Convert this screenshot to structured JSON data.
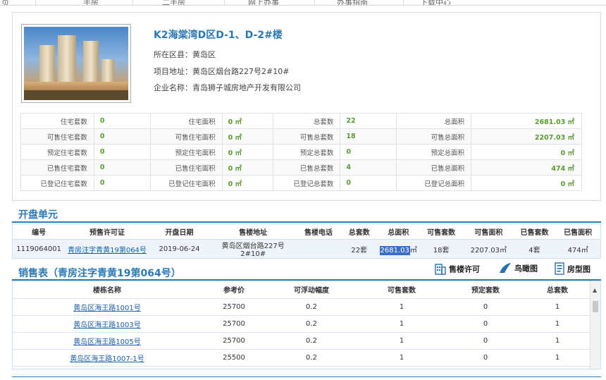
{
  "nav": [
    "页",
    "手房",
    "二手房",
    "网上办事",
    "办事指南",
    "下载中心"
  ],
  "project": {
    "title": "K2海棠湾D区D-1、D-2#楼",
    "district_label": "所在区县：",
    "district": "黄岛区",
    "address_label": "项目地址：",
    "address": "黄岛区烟台路227号2#10#",
    "company_label": "企业名称：",
    "company": "青岛狮子城房地产开发有限公司"
  },
  "stats": [
    [
      "住宅套数",
      "0",
      "住宅面积",
      "0 ㎡",
      "总套数",
      "22",
      "总面积",
      "2681.03 ㎡"
    ],
    [
      "可售住宅套数",
      "0",
      "可售住宅面积",
      "0 ㎡",
      "可售总套数",
      "18",
      "可售总面积",
      "2207.03 ㎡"
    ],
    [
      "预定住宅套数",
      "0",
      "预定住宅面积",
      "0 ㎡",
      "预定总套数",
      "0",
      "预定总面积",
      "0 ㎡"
    ],
    [
      "已售住宅套数",
      "0",
      "已售住宅面积",
      "0 ㎡",
      "已售总套数",
      "4",
      "已售总面积",
      "474 ㎡"
    ],
    [
      "已登记住宅套数",
      "0",
      "已登记住宅面积",
      "0 ㎡",
      "已登记总套数",
      "0",
      "已登记总面积",
      "0 ㎡"
    ]
  ],
  "units_section": {
    "title": "开盘单元",
    "headers": [
      "编号",
      "预售许可证",
      "开盘日期",
      "售楼地址",
      "售楼电话",
      "总套数",
      "总面积",
      "可售套数",
      "可售面积",
      "已售套数",
      "已售面积"
    ],
    "row": {
      "id": "1119064001",
      "permit": "青房注字青黄19第064号",
      "date": "2019-06-24",
      "address": "黄岛区烟台路227号2#10#",
      "phone": "",
      "total": "22套",
      "area": "2681.03",
      "area_unit": "㎡",
      "avail": "18套",
      "avail_area": "2207.03㎡",
      "sold": "4套",
      "sold_area": "474㎡"
    }
  },
  "sales_section": {
    "title": "销售表（青房注字青黄19第064号）",
    "tools": [
      "售楼许可",
      "鸟瞰图",
      "房型图"
    ],
    "headers": [
      "楼栋名称",
      "参考价",
      "可浮动幅度",
      "可售套数",
      "预定套数",
      "总套数"
    ],
    "rows": [
      [
        "黄岛区海王路1001号",
        "25700",
        "0.2",
        "1",
        "0",
        "1"
      ],
      [
        "黄岛区海王路1003号",
        "25700",
        "0.2",
        "1",
        "0",
        "1"
      ],
      [
        "黄岛区海王路1005号",
        "25700",
        "0.2",
        "1",
        "0",
        "1"
      ],
      [
        "黄岛区海王路1007-1号",
        "25500",
        "0.2",
        "1",
        "0",
        "1"
      ]
    ]
  }
}
